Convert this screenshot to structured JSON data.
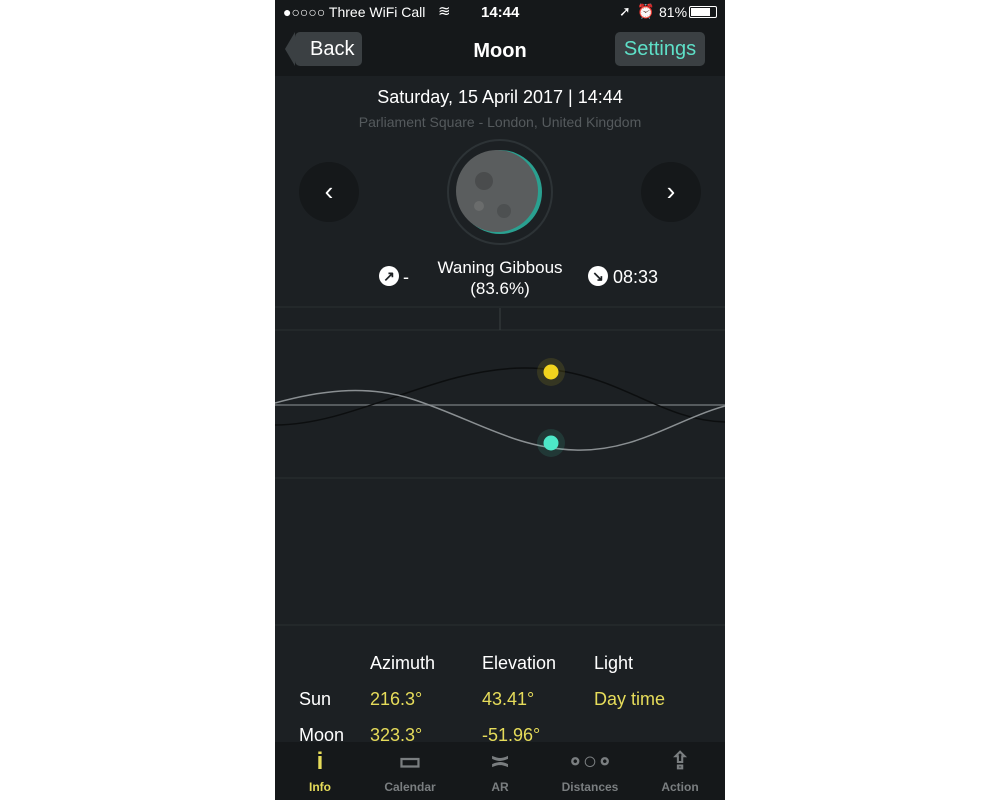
{
  "status": {
    "carrier": "●○○○○ Three WiFi Call",
    "time": "14:44",
    "battery": "81%"
  },
  "nav": {
    "back": "Back",
    "title": "Moon",
    "settings": "Settings"
  },
  "header": {
    "datetime": "Saturday, 15 April 2017 | 14:44",
    "location": "Parliament Square - London, United Kingdom"
  },
  "phase": {
    "name": "Waning Gibbous",
    "percent": "(83.6%)",
    "rise": "-",
    "set": "08:33",
    "rise_icon": "moonrise-arrow-icon",
    "set_icon": "moonset-arrow-icon"
  },
  "colors": {
    "sun": "#f2d41e",
    "moon": "#4de8c8",
    "accent": "#5ee0c8",
    "value": "#e6dc5a"
  },
  "table": {
    "headers": [
      "Azimuth",
      "Elevation",
      "Light"
    ],
    "rows": [
      {
        "label": "Sun",
        "azimuth": "216.3°",
        "elevation": "43.41°",
        "light": "Day time"
      },
      {
        "label": "Moon",
        "azimuth": "323.3°",
        "elevation": "-51.96°",
        "light": ""
      }
    ]
  },
  "tabs": [
    {
      "label": "Info",
      "icon": "info-icon",
      "active": true
    },
    {
      "label": "Calendar",
      "icon": "calendar-icon"
    },
    {
      "label": "AR",
      "icon": "ar-icon"
    },
    {
      "label": "Distances",
      "icon": "distances-icon"
    },
    {
      "label": "Action",
      "icon": "share-icon"
    }
  ]
}
